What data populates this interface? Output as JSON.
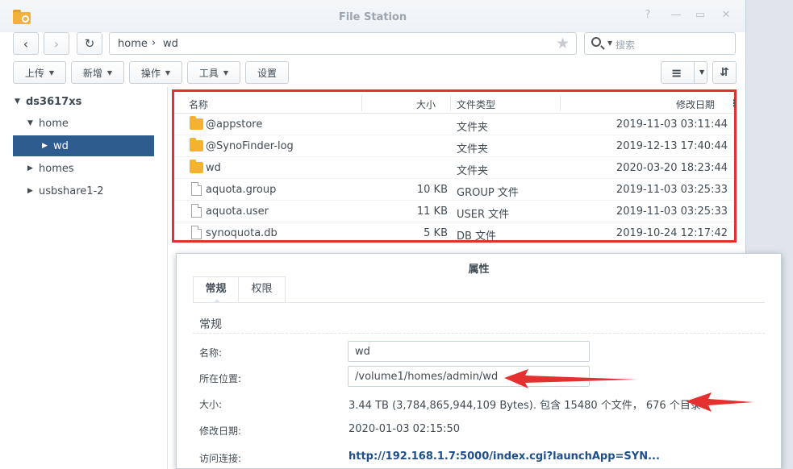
{
  "window": {
    "title": "File Station"
  },
  "toolbar": {
    "address_root": "home",
    "address_current": "wd",
    "search_placeholder": "搜索",
    "buttons": {
      "upload": "上传",
      "new": "新增",
      "action": "操作",
      "tools": "工具",
      "settings": "设置"
    }
  },
  "sidebar": {
    "root": "ds3617xs",
    "items": [
      "home",
      "wd",
      "homes",
      "usbshare1-2"
    ]
  },
  "file_list": {
    "columns": [
      "名称",
      "大小",
      "文件类型",
      "修改日期"
    ],
    "rows": [
      {
        "name": "@appstore",
        "size": "",
        "type": "文件夹",
        "date": "2019-11-03 03:11:44",
        "kind": "folder"
      },
      {
        "name": "@SynoFinder-log",
        "size": "",
        "type": "文件夹",
        "date": "2019-12-13 17:40:44",
        "kind": "folder"
      },
      {
        "name": "wd",
        "size": "",
        "type": "文件夹",
        "date": "2020-03-20 18:23:44",
        "kind": "folder"
      },
      {
        "name": "aquota.group",
        "size": "10 KB",
        "type": "GROUP 文件",
        "date": "2019-11-03 03:25:33",
        "kind": "file"
      },
      {
        "name": "aquota.user",
        "size": "11 KB",
        "type": "USER 文件",
        "date": "2019-11-03 03:25:33",
        "kind": "file"
      },
      {
        "name": "synoquota.db",
        "size": "5 KB",
        "type": "DB 文件",
        "date": "2019-10-24 12:17:42",
        "kind": "file"
      }
    ]
  },
  "properties": {
    "title": "属性",
    "tabs": [
      "常规",
      "权限"
    ],
    "section": "常规",
    "labels": {
      "name": "名称:",
      "location": "所在位置:",
      "size": "大小:",
      "modified": "修改日期:",
      "link": "访问连接:"
    },
    "values": {
      "name": "wd",
      "location": "/volume1/homes/admin/wd",
      "size": "3.44 TB (3,784,865,944,109 Bytes). 包含 15480 个文件， 676 个目录",
      "modified": "2020-01-03 02:15:50",
      "link": "http://192.168.1.7:5000/index.cgi?launchApp=SYN..."
    }
  },
  "colors": {
    "selection": "#2f5c8f",
    "highlight_border": "#e4312f",
    "arrow": "#e4312f",
    "link": "#1e4f8c"
  }
}
